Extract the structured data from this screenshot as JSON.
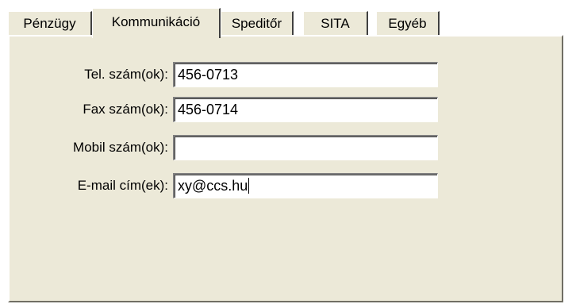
{
  "tabs": [
    {
      "label": "Pénzügy"
    },
    {
      "label": "Kommunikáció"
    },
    {
      "label": "Speditőr"
    },
    {
      "label": "SITA"
    },
    {
      "label": "Egyéb"
    }
  ],
  "active_tab": "Kommunikáció",
  "form": {
    "phone_label": "Tel. szám(ok):",
    "phone_value": "456-0713",
    "fax_label": "Fax szám(ok):",
    "fax_value": "456-0714",
    "mobile_label": "Mobil szám(ok):",
    "mobile_value": "",
    "email_label": "E-mail cím(ek):",
    "email_value": "xy@ccs.hu"
  },
  "colors": {
    "panel_background": "#ece9d8"
  }
}
